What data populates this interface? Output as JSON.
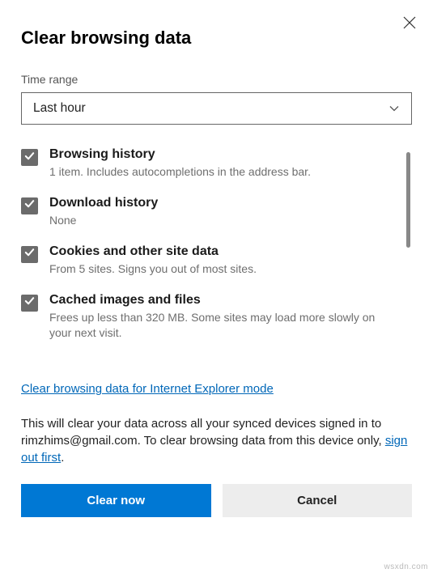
{
  "dialog": {
    "title": "Clear browsing data",
    "time_range_label": "Time range",
    "time_range_value": "Last hour",
    "ie_link": "Clear browsing data for Internet Explorer mode",
    "note_prefix": "This will clear your data across all your synced devices signed in to rimzhims@gmail.com. To clear browsing data from this device only, ",
    "note_link": "sign out first",
    "note_suffix": ".",
    "clear_button": "Clear now",
    "cancel_button": "Cancel"
  },
  "options": [
    {
      "title": "Browsing history",
      "desc": "1 item. Includes autocompletions in the address bar.",
      "checked": true
    },
    {
      "title": "Download history",
      "desc": "None",
      "checked": true
    },
    {
      "title": "Cookies and other site data",
      "desc": "From 5 sites. Signs you out of most sites.",
      "checked": true
    },
    {
      "title": "Cached images and files",
      "desc": "Frees up less than 320 MB. Some sites may load more slowly on your next visit.",
      "checked": true
    }
  ],
  "watermark": "wsxdn.com"
}
